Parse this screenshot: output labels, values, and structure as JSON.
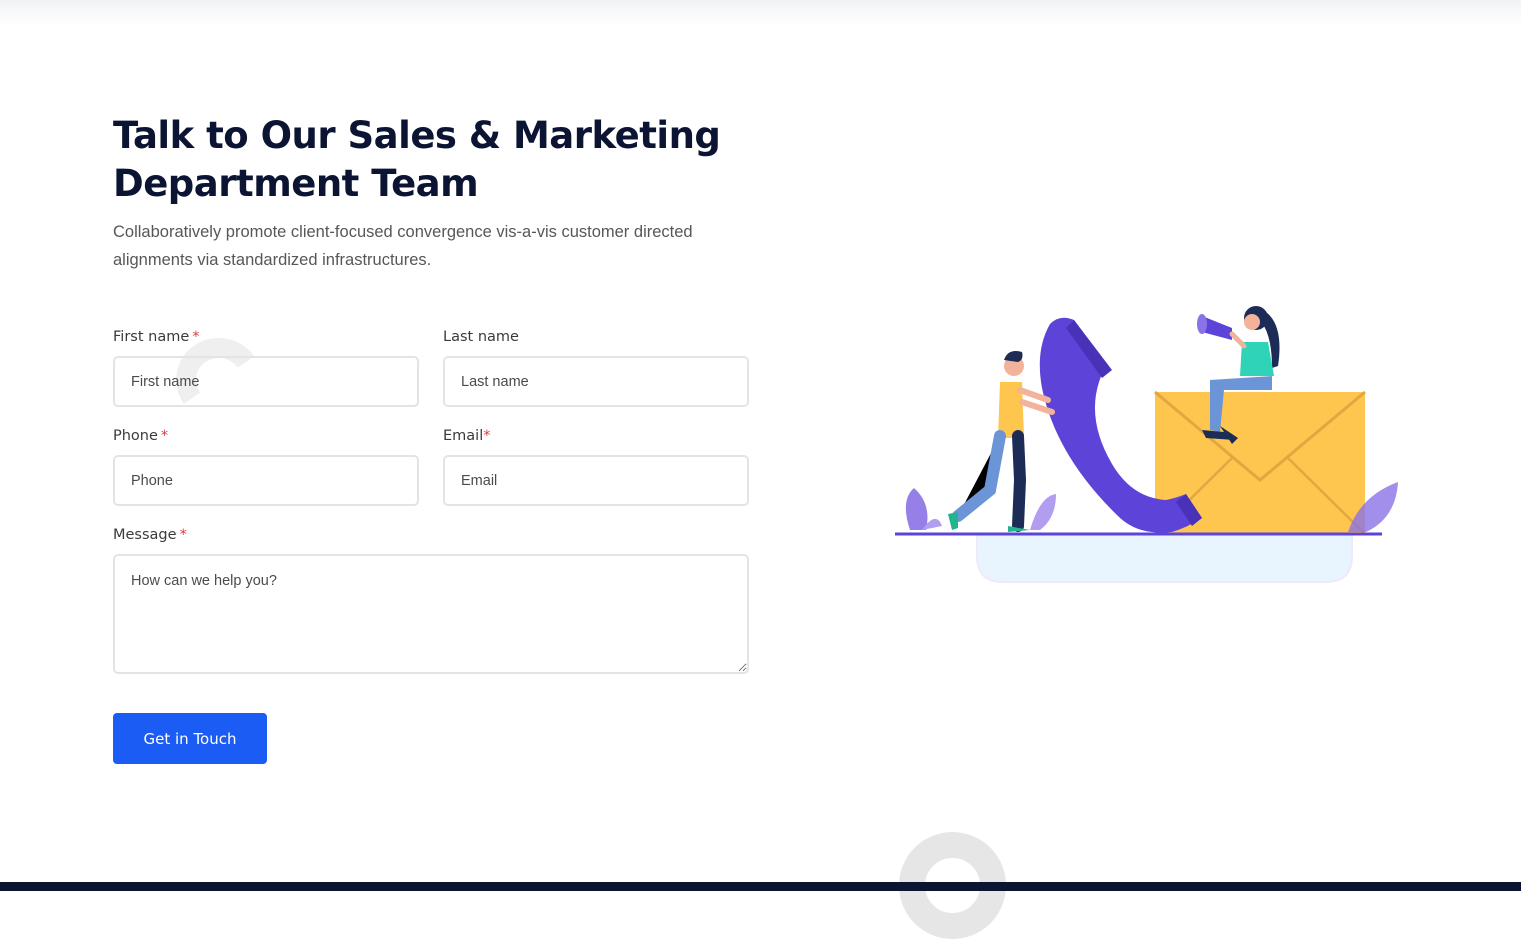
{
  "heading": {
    "title_line1": "Talk to Our Sales & Marketing",
    "title_line2": "Department Team",
    "subtitle": "Collaboratively promote client-focused convergence vis-a-vis customer directed alignments via standardized infrastructures."
  },
  "form": {
    "first_name": {
      "label": "First name",
      "required_mark": "*",
      "placeholder": "First name",
      "value": ""
    },
    "last_name": {
      "label": "Last name",
      "placeholder": "Last name",
      "value": ""
    },
    "phone": {
      "label": "Phone",
      "required_mark": "*",
      "placeholder": "Phone",
      "value": ""
    },
    "email": {
      "label": "Email",
      "required_mark": "*",
      "placeholder": "Email",
      "value": ""
    },
    "message": {
      "label": "Message",
      "required_mark": "*",
      "placeholder": "How can we help you?",
      "value": ""
    },
    "submit_label": "Get in Touch"
  },
  "illustration": {
    "icon": "contact-illustration",
    "colors": {
      "phone": "#5e43d8",
      "envelope": "#fec64f",
      "ground": "#5e43d8",
      "platform": "#e8f4fe",
      "leaves": "#8b72e6"
    }
  },
  "colors": {
    "title": "#0b1533",
    "button": "#1b5cf5",
    "required": "#e5383b",
    "footer": "#0b1533"
  }
}
